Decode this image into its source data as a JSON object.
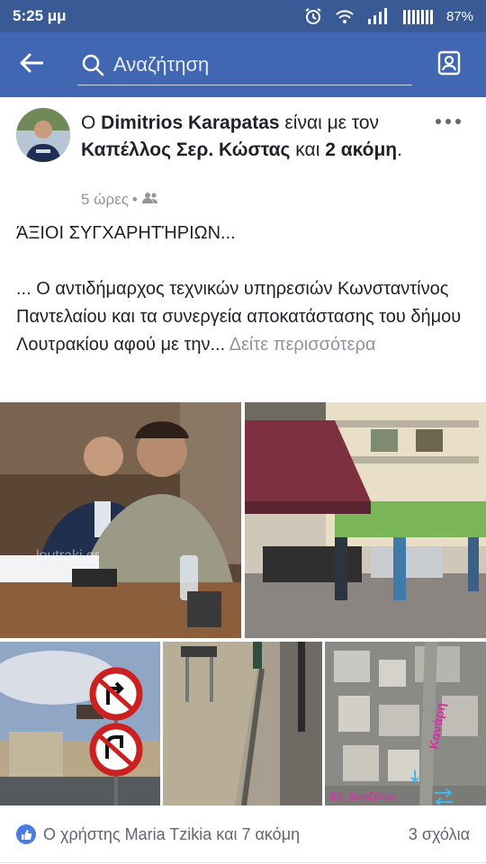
{
  "status_bar": {
    "time": "5:25 μμ",
    "battery": "87%",
    "icons": [
      "alarm-icon",
      "wifi-icon",
      "signal-icon",
      "signal-icon",
      "battery-icon"
    ]
  },
  "app_bar": {
    "search_placeholder": "Αναζήτηση",
    "icons": [
      "back-arrow-icon",
      "search-icon",
      "profile-card-icon"
    ]
  },
  "post": {
    "author_prefix": "Ο ",
    "author": "Dimitrios Karapatas",
    "with_text": " είναι με τον ",
    "tagged": "Καπέλλος Σερ. Κώστας",
    "and_text": " και ",
    "others": "2 ακόμη",
    "period": ".",
    "time": "5 ώρες",
    "dot": "•",
    "audience_icon": "friends-icon",
    "paragraph1": "ΆΞΙΟΙ ΣΥΓΧΑΡΗΤΉΡΙΩΝ...",
    "paragraph2": "... Ο αντιδήμαρχος τεχνικών υπηρεσιών Κωνσταντίνος Παντελαίου και τα συνεργεία αποκατάστασης του δήμου Λουτρακίου αφού με την...",
    "see_more": "Δείτε περισσότερα",
    "photos": [
      {
        "alt": "men-at-council-meeting",
        "watermark": "loutraki.gr"
      },
      {
        "alt": "street-corner-workers"
      },
      {
        "alt": "traffic-signs"
      },
      {
        "alt": "street-sidewalk"
      },
      {
        "alt": "aerial-map",
        "map_label1": "Κανάρη",
        "map_label2": "Ελ. Βενιζέλου"
      }
    ]
  },
  "footer": {
    "likes": "Ο χρήστης Maria Tzikia και 7 ακόμη",
    "comments": "3 σχόλια"
  },
  "colors": {
    "fb_blue": "#4267b2",
    "status_blue": "#3a5a96",
    "text": "#1d2129",
    "meta_gray": "#90949c"
  }
}
